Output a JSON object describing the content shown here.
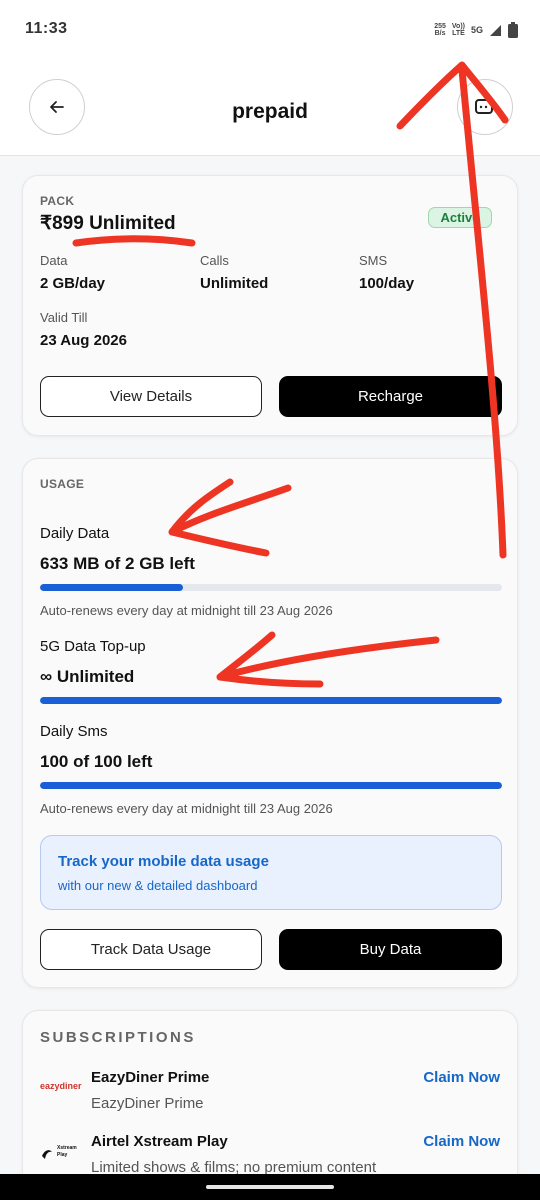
{
  "status_bar": {
    "time": "11:33",
    "speed_value": "255",
    "speed_unit": "B/s",
    "volte_top": "Vo))",
    "volte_bottom": "LTE",
    "network": "5G"
  },
  "header": {
    "title": "prepaid"
  },
  "pack": {
    "section_label": "PACK",
    "name": "₹899 Unlimited",
    "status": "Active",
    "details": [
      {
        "label": "Data",
        "value": "2 GB/day"
      },
      {
        "label": "Calls",
        "value": "Unlimited"
      },
      {
        "label": "SMS",
        "value": "100/day"
      }
    ],
    "valid_label": "Valid Till",
    "valid_value": "23 Aug 2026",
    "view_details_label": "View Details",
    "recharge_label": "Recharge"
  },
  "usage": {
    "section_label": "USAGE",
    "daily_data": {
      "title": "Daily Data",
      "value": "633 MB of 2 GB left",
      "remaining_fraction": 0.309,
      "note": "Auto-renews every day at midnight till 23 Aug 2026"
    },
    "topup": {
      "title": "5G Data Top-up",
      "value": "∞ Unlimited",
      "remaining_fraction": 1.0
    },
    "daily_sms": {
      "title": "Daily Sms",
      "value": "100 of 100 left",
      "remaining_fraction": 1.0,
      "note": "Auto-renews every day at midnight till 23 Aug 2026"
    },
    "promo_title": "Track your mobile data usage",
    "promo_subtitle": "with our new & detailed dashboard",
    "track_label": "Track Data Usage",
    "buy_label": "Buy Data"
  },
  "subscriptions": {
    "section_label": "SUBSCRIPTIONS",
    "items": [
      {
        "logo_text": "eazydiner",
        "title": "EazyDiner Prime",
        "subtitle": "EazyDiner Prime",
        "action": "Claim Now"
      },
      {
        "logo_text_1": "Xstream",
        "logo_text_2": "Play",
        "title": "Airtel Xstream Play",
        "subtitle": "Limited shows & films; no premium content",
        "action": "Claim Now"
      }
    ]
  },
  "colors": {
    "accent": "#1a5fd6",
    "active_green": "#1e7f3c",
    "annotation_red": "#ee3524",
    "link_blue": "#1767c9"
  }
}
